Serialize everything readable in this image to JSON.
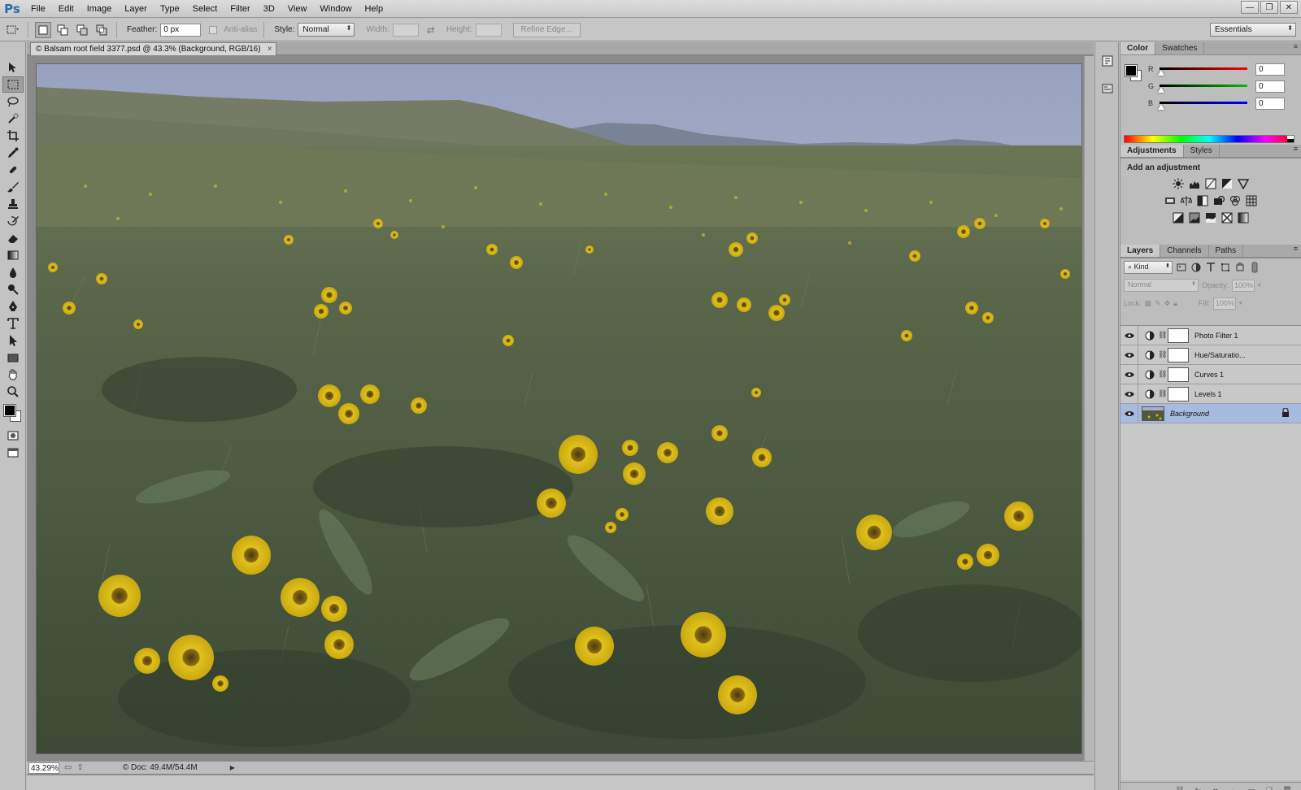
{
  "app": {
    "logo": "Ps"
  },
  "menu": [
    "File",
    "Edit",
    "Image",
    "Layer",
    "Type",
    "Select",
    "Filter",
    "3D",
    "View",
    "Window",
    "Help"
  ],
  "window_controls": {
    "minimize": "—",
    "restore": "❐",
    "close": "✕"
  },
  "options": {
    "feather_label": "Feather:",
    "feather_value": "0 px",
    "antialias_label": "Anti-alias",
    "style_label": "Style:",
    "style_value": "Normal",
    "width_label": "Width:",
    "height_label": "Height:",
    "refine_edge": "Refine Edge...",
    "workspace": "Essentials"
  },
  "document": {
    "tab_title": "© Balsam root field 3377.psd @ 43.3% (Background, RGB/16)",
    "tab_close": "×",
    "zoom": "43.29%",
    "doc_size": "© Doc: 49.4M/54.4M"
  },
  "color_panel": {
    "tabs": [
      "Color",
      "Swatches"
    ],
    "active_tab": "Color",
    "r_label": "R",
    "g_label": "G",
    "b_label": "B",
    "r_value": "0",
    "g_value": "0",
    "b_value": "0",
    "fg_color": "#000000",
    "bg_color": "#ffffff"
  },
  "adjustments_panel": {
    "tabs": [
      "Adjustments",
      "Styles"
    ],
    "active_tab": "Adjustments",
    "title": "Add an adjustment"
  },
  "layers_panel": {
    "tabs": [
      "Layers",
      "Channels",
      "Paths"
    ],
    "active_tab": "Layers",
    "filter_kind": "Kind",
    "blend_mode": "Normal",
    "opacity_label": "Opacity:",
    "opacity_value": "100%",
    "lock_label": "Lock:",
    "fill_label": "Fill:",
    "fill_value": "100%",
    "layers": [
      {
        "name": "Photo Filter 1",
        "type": "adjustment",
        "selected": false
      },
      {
        "name": "Hue/Saturatio...",
        "type": "adjustment",
        "selected": false
      },
      {
        "name": "Curves 1",
        "type": "adjustment",
        "selected": false
      },
      {
        "name": "Levels 1",
        "type": "adjustment",
        "selected": false
      },
      {
        "name": "Background",
        "type": "image",
        "selected": true
      }
    ],
    "bottom_icons": [
      "link-icon",
      "fx-icon",
      "mask-icon",
      "adjustment-icon",
      "group-icon",
      "new-layer-icon",
      "trash-icon"
    ]
  },
  "colors": {
    "chrome": "#c3c3c3",
    "selected_layer": "#a7bbe0",
    "accent_blue": "#2a6bb4"
  }
}
